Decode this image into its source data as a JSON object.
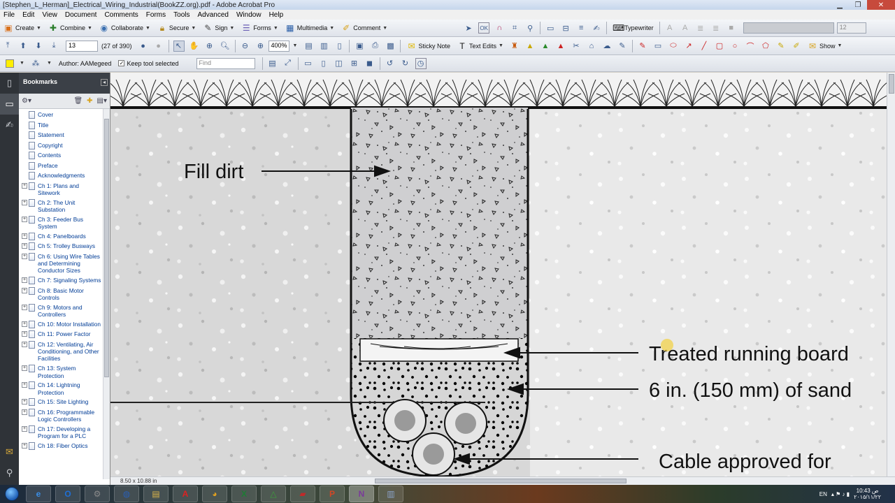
{
  "window": {
    "title": "[Stephen_L_Herman]_Electrical_Wiring_Industrial(BookZZ.org).pdf - Adobe Acrobat Pro"
  },
  "menu": [
    "File",
    "Edit",
    "View",
    "Document",
    "Comments",
    "Forms",
    "Tools",
    "Advanced",
    "Window",
    "Help"
  ],
  "toolbar1": {
    "create": "Create",
    "combine": "Combine",
    "collaborate": "Collaborate",
    "secure": "Secure",
    "sign": "Sign",
    "forms": "Forms",
    "multimedia": "Multimedia",
    "comment": "Comment",
    "typewriter": "Typewriter",
    "font_size": "12"
  },
  "toolbar2": {
    "page_number": "13",
    "page_count": "(27 of 390)",
    "zoom": "400%",
    "sticky_note": "Sticky Note",
    "text_edits": "Text Edits",
    "show": "Show"
  },
  "toolbar3": {
    "author": "Author: AAMegeed",
    "keep_tool": "Keep tool selected",
    "find_placeholder": "Find"
  },
  "bookmarks": {
    "title": "Bookmarks",
    "items": [
      {
        "label": "Cover",
        "expandable": false
      },
      {
        "label": "Title",
        "expandable": false
      },
      {
        "label": "Statement",
        "expandable": false
      },
      {
        "label": "Copyright",
        "expandable": false
      },
      {
        "label": "Contents",
        "expandable": false
      },
      {
        "label": "Preface",
        "expandable": false
      },
      {
        "label": "Acknowledgments",
        "expandable": false
      },
      {
        "label": "Ch 1: Plans and Sitework",
        "expandable": true
      },
      {
        "label": "Ch 2: The Unit Substation",
        "expandable": true
      },
      {
        "label": "Ch 3: Feeder Bus System",
        "expandable": true
      },
      {
        "label": "Ch 4: Panelboards",
        "expandable": true
      },
      {
        "label": "Ch 5: Trolley Busways",
        "expandable": true
      },
      {
        "label": "Ch 6: Using Wire Tables and Determining Conductor Sizes",
        "expandable": true
      },
      {
        "label": "Ch 7: Signaling Systems",
        "expandable": true
      },
      {
        "label": "Ch 8: Basic Motor Controls",
        "expandable": true
      },
      {
        "label": "Ch 9: Motors and Controllers",
        "expandable": true
      },
      {
        "label": "Ch 10: Motor Installation",
        "expandable": true
      },
      {
        "label": "Ch 11: Power Factor",
        "expandable": true
      },
      {
        "label": "Ch 12: Ventilating, Air Conditioning, and Other Facilities",
        "expandable": true
      },
      {
        "label": "Ch 13: System Protection",
        "expandable": true
      },
      {
        "label": "Ch 14: Lightning Protection",
        "expandable": true
      },
      {
        "label": "Ch 15: Site Lighting",
        "expandable": true
      },
      {
        "label": "Ch 16: Programmable Logic Controllers",
        "expandable": true
      },
      {
        "label": "Ch 17: Developing a Program for a PLC",
        "expandable": true
      },
      {
        "label": "Ch 18: Fiber Optics",
        "expandable": true
      }
    ]
  },
  "document": {
    "page_size": "8.50 x 10.88 in",
    "labels": {
      "fill_dirt": "Fill dirt",
      "running_board": "Treated running board",
      "sand": "6 in. (150 mm) of sand",
      "cable": "Cable approved for"
    }
  },
  "taskbar": {
    "apps": [
      "IE",
      "Outlook",
      "Tool",
      "Globe",
      "Explorer",
      "Acrobat",
      "Chrome",
      "Excel",
      "Triangle",
      "Reader",
      "PowerPoint",
      "OneNote",
      "Notepad"
    ],
    "language": "EN",
    "time": "10:43 ص",
    "date": "٢٠١٥/١١/٢٢"
  },
  "colors": {
    "accent": "#3b4047",
    "link": "#003c96"
  }
}
